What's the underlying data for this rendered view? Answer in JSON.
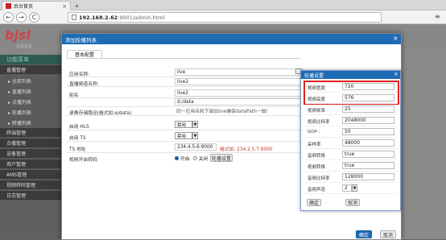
{
  "browser": {
    "tab_title": "后台首页",
    "tab_close": "×",
    "new_tab": "+",
    "back": "←",
    "forward": "→",
    "reload": "C",
    "url_host": "192.168.2.62",
    "url_path": ":9001/admin.html",
    "menu": "≡"
  },
  "app": {
    "logo": "bjsl",
    "logo_sub": "北极星者",
    "sidebar": [
      {
        "label": "功能菜单",
        "kind": "head"
      },
      {
        "label": "直播管理",
        "kind": "grp"
      },
      {
        "label": "▸ 全部列表",
        "kind": "sub"
      },
      {
        "label": "▸ 直播列表",
        "kind": "sub"
      },
      {
        "label": "▸ 点播列表",
        "kind": "sub"
      },
      {
        "label": "▸ 轮播列表",
        "kind": "sub"
      },
      {
        "label": "▸ 转播列表",
        "kind": "sub"
      },
      {
        "label": "终端管理",
        "kind": "grp"
      },
      {
        "label": "点播管理",
        "kind": "grp"
      },
      {
        "label": "设备管理",
        "kind": "grp"
      },
      {
        "label": "用户管理",
        "kind": "grp"
      },
      {
        "label": "AMS管理",
        "kind": "grp"
      },
      {
        "label": "视频转码管理",
        "kind": "grp"
      },
      {
        "label": "日志管理",
        "kind": "grp"
      }
    ]
  },
  "modal": {
    "title": "添加轮播列表",
    "close": "×",
    "tab": "基本配置",
    "rows": [
      {
        "label": "应用名称:",
        "value": "live"
      },
      {
        "label": "直播频道名称:",
        "value": "live2"
      },
      {
        "label": "别名",
        "value": "live2"
      },
      {
        "label": "",
        "value": "d:/data"
      },
      {
        "label": "录像存储路径(格式如:e/data)",
        "value": "同一应用名和下面加live确保dataPath一致!"
      }
    ],
    "hls_label": "启用 HLS",
    "hls_value": "禁用",
    "ts_label": "启用 TS",
    "ts_value": "禁用",
    "ts_addr_label": "TS 地址",
    "ts_addr_value": "234.4.5.6:9000",
    "ts_addr_hint": "格式如: 234.2.5.7:9000",
    "transcode_label": "视频开启转码",
    "radio_on": "开启",
    "radio_off": "关闭",
    "setting_button": "轮播设置",
    "confirm": "确定",
    "cancel": "取消"
  },
  "panel": {
    "title": "轮播设置",
    "close": "×",
    "rows": [
      {
        "label": "视频宽度",
        "value": "720"
      },
      {
        "label": "视频高度",
        "value": "576"
      },
      {
        "label": "视频帧率",
        "value": "25"
      },
      {
        "label": "视频比特率",
        "value": "2048000"
      },
      {
        "label": "GOP :",
        "value": "50"
      },
      {
        "label": "采样率",
        "value": "48000"
      },
      {
        "label": "音频转换",
        "value": "true"
      },
      {
        "label": "视频转换",
        "value": "true"
      },
      {
        "label": "音频比特率",
        "value": "128000"
      },
      {
        "label": "音频声道",
        "value": "2"
      }
    ],
    "ok": "确定",
    "cancel": "取消"
  },
  "colors": {
    "accent": "#1d6bb3",
    "highlight": "#e02020"
  }
}
